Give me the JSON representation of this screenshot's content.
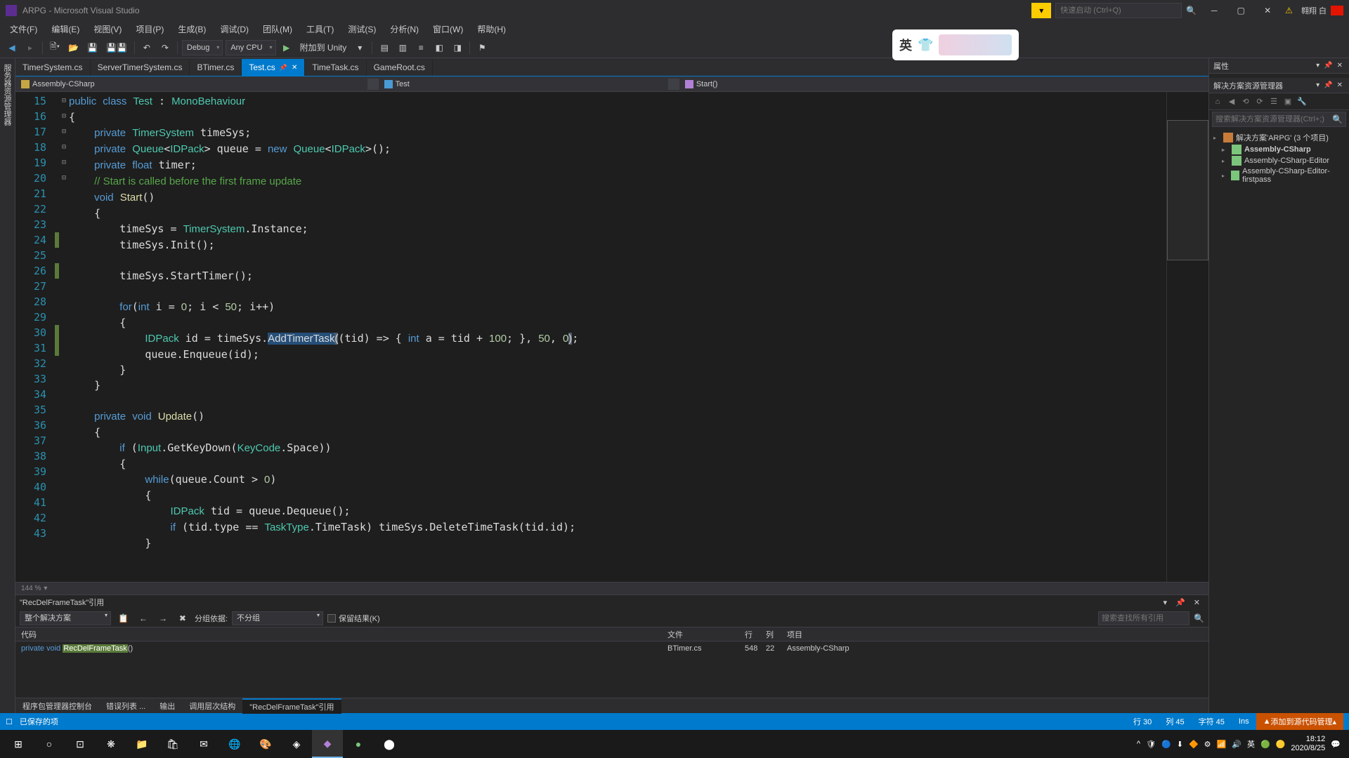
{
  "titlebar": {
    "title": "ARPG - Microsoft Visual Studio",
    "search_placeholder": "快速启动 (Ctrl+Q)",
    "user": "翱翔 白"
  },
  "menu": {
    "file": "文件(F)",
    "edit": "编辑(E)",
    "view": "视图(V)",
    "project": "项目(P)",
    "build": "生成(B)",
    "debug": "调试(D)",
    "team": "团队(M)",
    "tool": "工具(T)",
    "test": "测试(S)",
    "analyze": "分析(N)",
    "window": "窗口(W)",
    "help": "帮助(H)"
  },
  "toolbar": {
    "config": "Debug",
    "platform": "Any CPU",
    "attach": "附加到 Unity"
  },
  "tabs": {
    "t1": "TimerSystem.cs",
    "t2": "ServerTimerSystem.cs",
    "t3": "BTimer.cs",
    "t4": "Test.cs",
    "t5": "TimeTask.cs",
    "t6": "GameRoot.cs"
  },
  "breadcrumb": {
    "project": "Assembly-CSharp",
    "class": "Test",
    "method": "Start()"
  },
  "code_lines": [
    "15",
    "16",
    "17",
    "18",
    "19",
    "20",
    "21",
    "22",
    "23",
    "24",
    "25",
    "26",
    "27",
    "28",
    "29",
    "30",
    "31",
    "32",
    "33",
    "34",
    "35",
    "36",
    "37",
    "38",
    "39",
    "40",
    "41",
    "42",
    "43"
  ],
  "zoom": "144 %",
  "find": {
    "title": "\"RecDelFrameTask\"引用",
    "scope": "整个解决方案",
    "group_label": "分组依据:",
    "group_value": "不分组",
    "keep": "保留结果(K)",
    "search_ph": "搜索查找所有引用",
    "cols": {
      "code": "代码",
      "file": "文件",
      "line": "行",
      "col": "列",
      "project": "项目"
    },
    "row": {
      "prefix": "private void ",
      "hl": "RecDelFrameTask",
      "suffix": "()",
      "file": "BTimer.cs",
      "line": "548",
      "col": "22",
      "project": "Assembly-CSharp"
    }
  },
  "bottom_tabs": {
    "t1": "程序包管理器控制台",
    "t2": "错误列表 ...",
    "t3": "输出",
    "t4": "调用层次结构",
    "t5": "\"RecDelFrameTask\"引用"
  },
  "properties": {
    "title": "属性"
  },
  "solution": {
    "title": "解决方案资源管理器",
    "search_ph": "搜索解决方案资源管理器(Ctrl+;)",
    "root": "解决方案'ARPG' (3 个项目)",
    "p1": "Assembly-CSharp",
    "p2": "Assembly-CSharp-Editor",
    "p3": "Assembly-CSharp-Editor-firstpass"
  },
  "status": {
    "saved": "已保存的项",
    "line": "行 30",
    "col": "列 45",
    "char": "字符 45",
    "ins": "Ins",
    "git": "添加到源代码管理"
  },
  "taskbar": {
    "time": "18:12",
    "date": "2020/8/25"
  },
  "ime": {
    "char": "英"
  }
}
